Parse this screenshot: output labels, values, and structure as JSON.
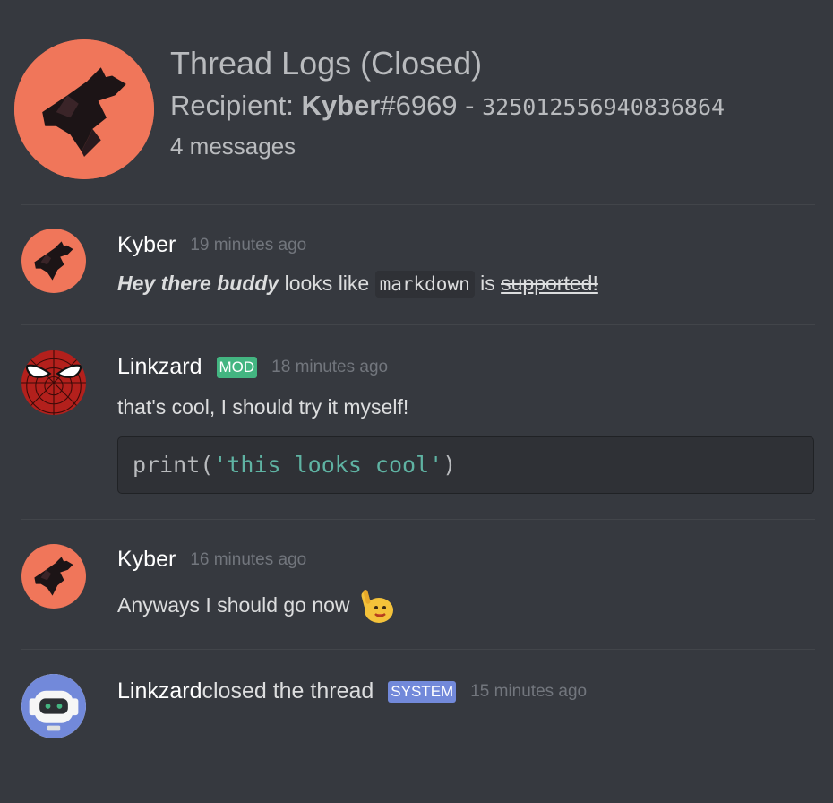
{
  "header": {
    "title": "Thread Logs (Closed)",
    "recipient_prefix": "Recipient: ",
    "recipient_name": "Kyber",
    "recipient_discriminator": "#6969",
    "recipient_sep": " - ",
    "recipient_id": "325012556940836864",
    "message_count": "4 messages"
  },
  "messages": [
    {
      "author": "Kyber",
      "timestamp": "19 minutes ago",
      "content": {
        "bold_italic": "Hey there buddy",
        "text1": " looks like ",
        "code": "markdown",
        "text2": " is ",
        "strike": "supported!"
      }
    },
    {
      "author": "Linkzard",
      "badge": "MOD",
      "timestamp": "18 minutes ago",
      "content": {
        "text": "that's cool, I should try it myself!",
        "codeblock_fn": "print(",
        "codeblock_str": "'this looks cool'",
        "codeblock_end": ")"
      }
    },
    {
      "author": "Kyber",
      "timestamp": "16 minutes ago",
      "content": {
        "text": "Anyways I should go now",
        "emoji": "wave-emoji"
      }
    },
    {
      "system": true,
      "author": "Linkzard",
      "action": " closed the thread",
      "badge": "SYSTEM",
      "timestamp": "15 minutes ago"
    }
  ],
  "colors": {
    "background": "#36393f",
    "avatar_orange": "#f0765a",
    "mod_badge": "#43b581",
    "system_badge": "#7289da",
    "code_string": "#5fb3a3"
  }
}
